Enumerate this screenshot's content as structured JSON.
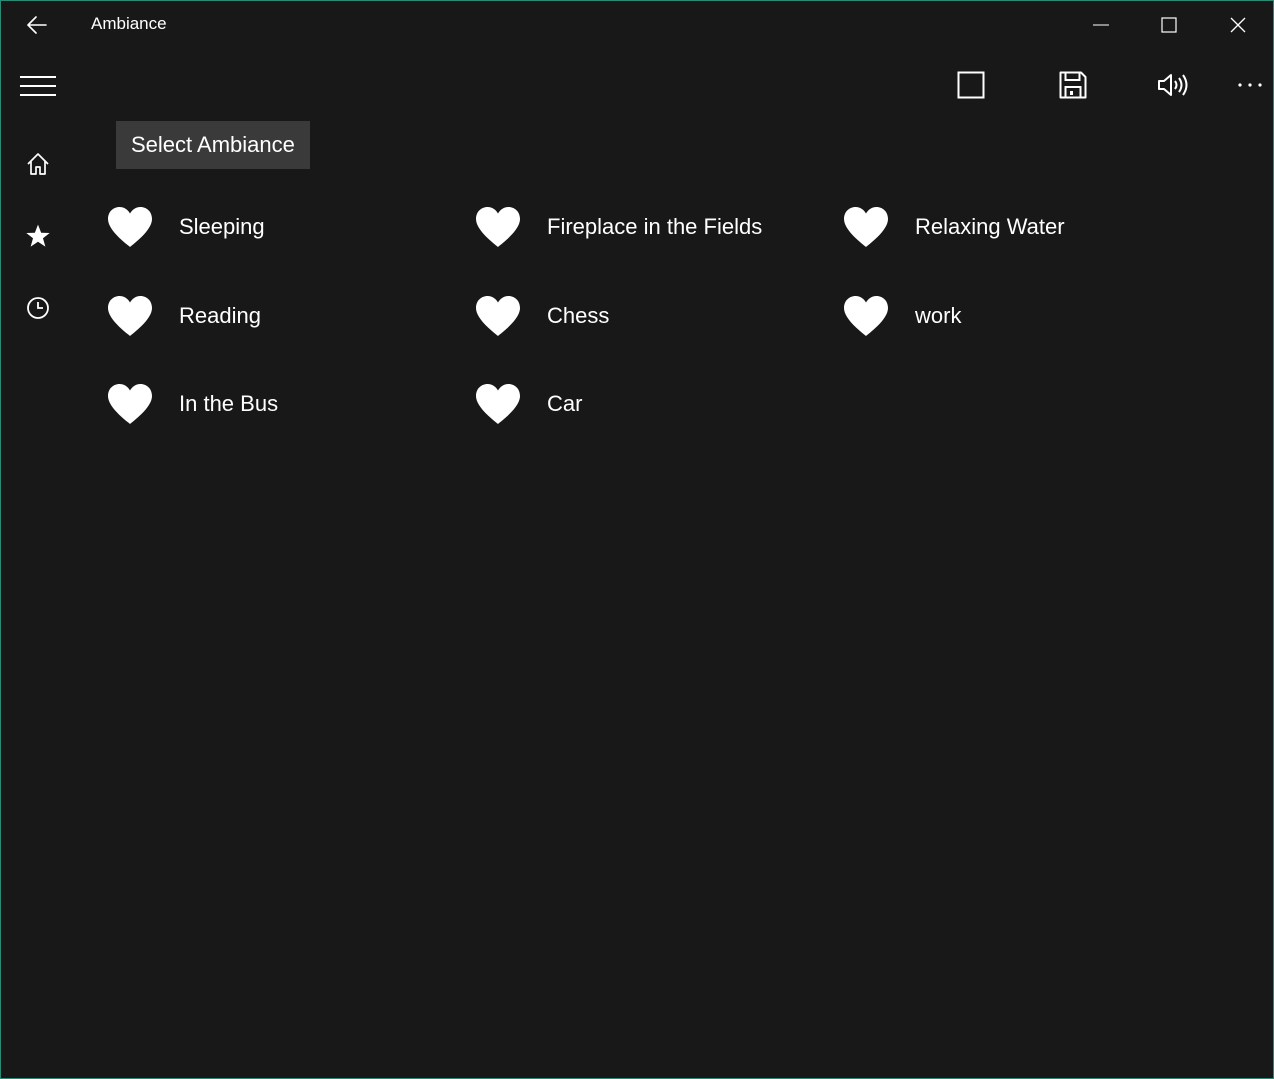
{
  "window": {
    "title": "Ambiance"
  },
  "titlebar": {
    "back_icon": "back-arrow-icon",
    "controls": [
      "minimize",
      "maximize",
      "close"
    ]
  },
  "nav": {
    "items": [
      {
        "name": "home",
        "icon": "home-icon"
      },
      {
        "name": "favorites",
        "icon": "star-icon"
      },
      {
        "name": "recent",
        "icon": "clock-icon"
      }
    ]
  },
  "command_bar": {
    "buttons": [
      "stop-icon",
      "save-icon",
      "volume-icon",
      "more-icon"
    ]
  },
  "main": {
    "select_label": "Select Ambiance",
    "ambiances": [
      {
        "label": "Sleeping",
        "icon": "heart-icon"
      },
      {
        "label": "Fireplace in the Fields",
        "icon": "heart-icon"
      },
      {
        "label": "Relaxing Water",
        "icon": "heart-icon"
      },
      {
        "label": "Reading",
        "icon": "heart-icon"
      },
      {
        "label": "Chess",
        "icon": "heart-icon"
      },
      {
        "label": "work",
        "icon": "heart-icon"
      },
      {
        "label": "In the Bus",
        "icon": "heart-icon"
      },
      {
        "label": "Car",
        "icon": "heart-icon"
      }
    ]
  },
  "colors": {
    "background": "#181818",
    "accent_border": "#2a8a74",
    "label_bg": "#3a3a3a",
    "foreground": "#ffffff"
  }
}
